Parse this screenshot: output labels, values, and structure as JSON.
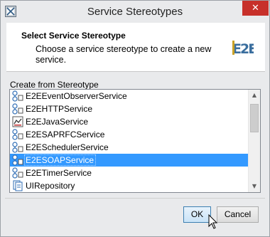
{
  "window": {
    "title": "Service Stereotypes",
    "close_glyph": "✕",
    "icon": "app-icon"
  },
  "header": {
    "title": "Select Service Stereotype",
    "description": "Choose a service stereotype to create a new service.",
    "logo_text": "E2E"
  },
  "list": {
    "label": "Create from Stereotype",
    "items": [
      {
        "label": "E2EEventObserverService",
        "icon": "service-icon"
      },
      {
        "label": "E2EHTTPService",
        "icon": "service-icon"
      },
      {
        "label": "E2EJavaService",
        "icon": "java-icon"
      },
      {
        "label": "E2ESAPRFCService",
        "icon": "service-icon"
      },
      {
        "label": "E2ESchedulerService",
        "icon": "service-icon"
      },
      {
        "label": "E2ESOAPService",
        "icon": "service-icon",
        "selected": true
      },
      {
        "label": "E2ETimerService",
        "icon": "service-icon"
      },
      {
        "label": "UIRepository",
        "icon": "repository-icon"
      }
    ]
  },
  "buttons": {
    "ok_label": "OK",
    "cancel_label": "Cancel"
  },
  "colors": {
    "selection": "#3399ff",
    "close_button": "#c7302a",
    "logo_accent": "#3a6e9e",
    "logo_gold": "#c9a227"
  }
}
